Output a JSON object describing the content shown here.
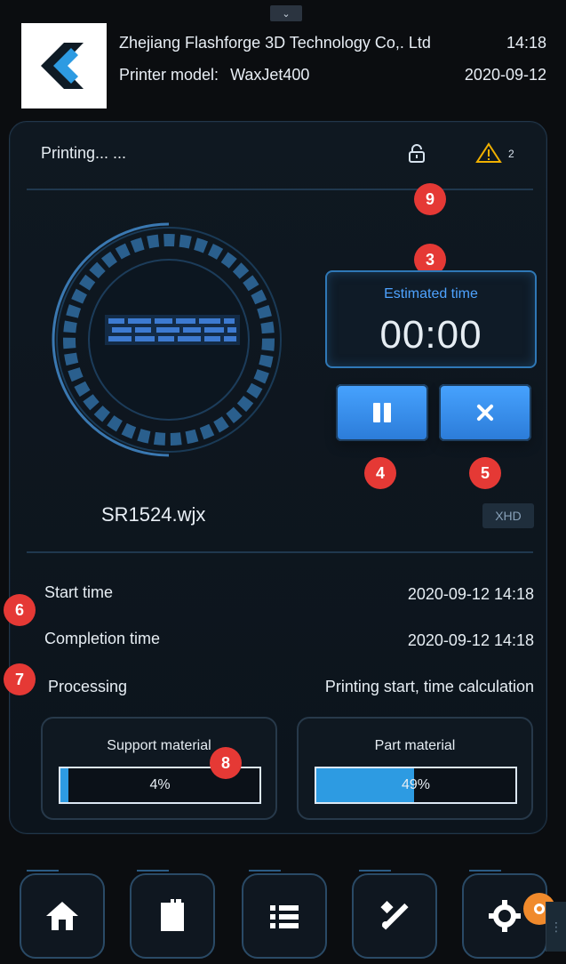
{
  "header": {
    "company": "Zhejiang Flashforge 3D Technology Co,. Ltd",
    "model_label": "Printer model:",
    "model_value": "WaxJet400",
    "time": "14:18",
    "date": "2020-09-12"
  },
  "status": {
    "text": "Printing... ...",
    "warnings": "2",
    "icons": {
      "lock": "lock-icon",
      "warning": "warning-icon"
    }
  },
  "job": {
    "filename": "SR1524.wjx",
    "estimated_label": "Estimated time",
    "estimated_value": "00:00",
    "quality": "XHD"
  },
  "details": {
    "start_label": "Start time",
    "start_value": "2020-09-12 14:18",
    "completion_label": "Completion time",
    "completion_value": "2020-09-12 14:18",
    "processing_label": "Processing",
    "processing_value": "Printing start, time calculation"
  },
  "materials": {
    "support": {
      "label": "Support material",
      "percent_text": "4%",
      "fraction": 0.04
    },
    "part": {
      "label": "Part material",
      "percent_text": "49%",
      "fraction": 0.49
    }
  },
  "badges": {
    "b3": "3",
    "b4": "4",
    "b5": "5",
    "b6": "6",
    "b7": "7",
    "b8": "8",
    "b9": "9"
  },
  "nav": [
    "home-icon",
    "file-icon",
    "list-icon",
    "tools-icon",
    "settings-icon"
  ],
  "colors": {
    "accent": "#2d9be2",
    "badge": "#e53935",
    "panel": "#0f1821"
  }
}
